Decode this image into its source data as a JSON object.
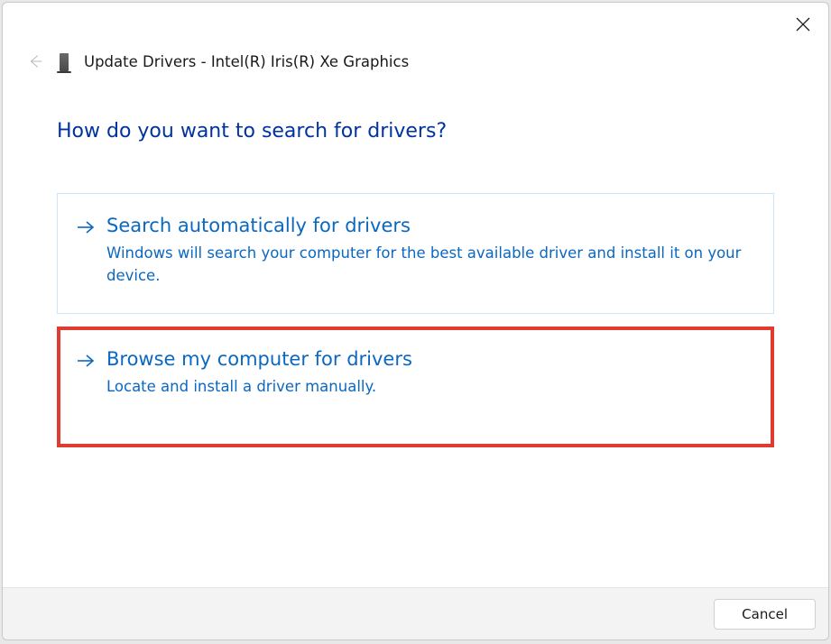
{
  "window": {
    "title": "Update Drivers - Intel(R) Iris(R) Xe Graphics"
  },
  "heading": "How do you want to search for drivers?",
  "options": {
    "auto": {
      "title": "Search automatically for drivers",
      "desc": "Windows will search your computer for the best available driver and install it on your device."
    },
    "manual": {
      "title": "Browse my computer for drivers",
      "desc": "Locate and install a driver manually."
    }
  },
  "footer": {
    "cancel_label": "Cancel"
  }
}
